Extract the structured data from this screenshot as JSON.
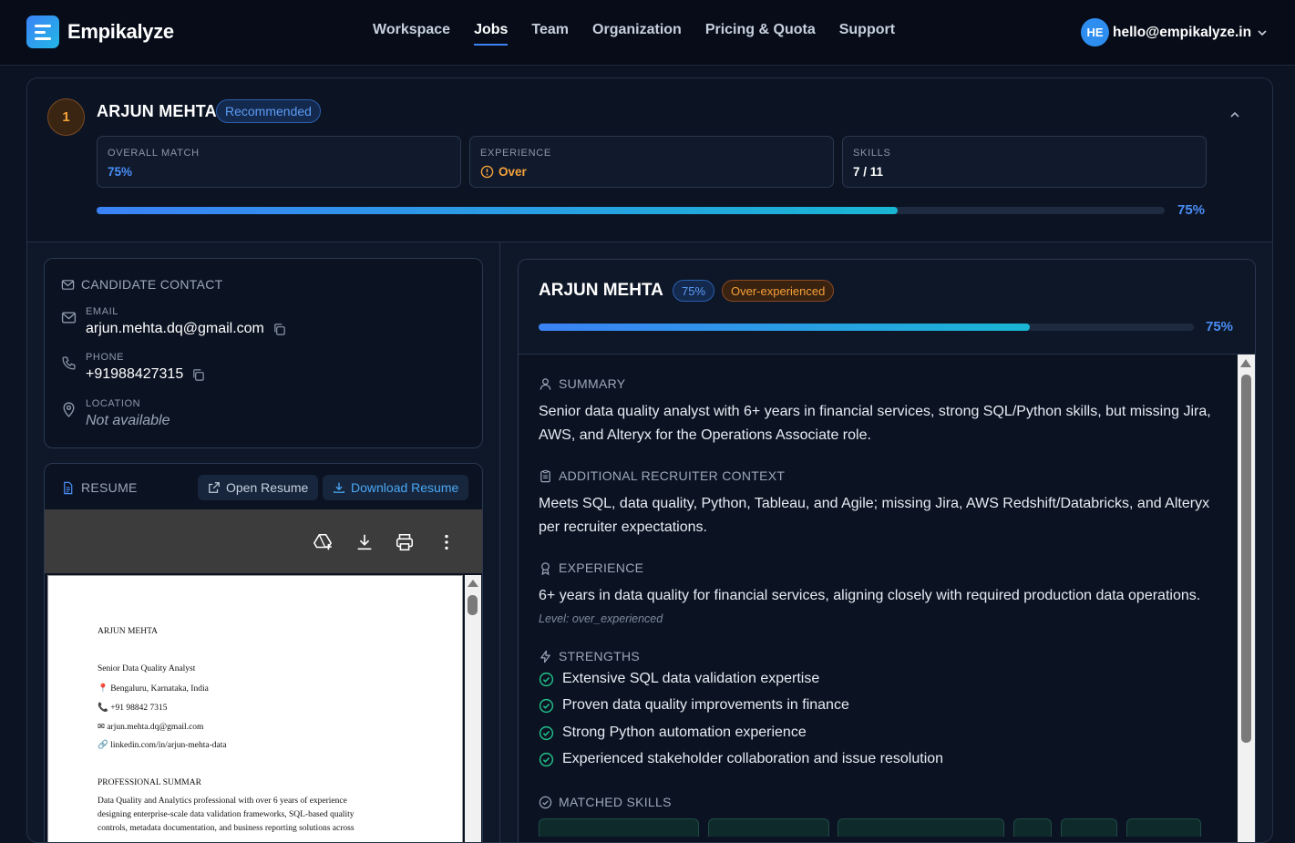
{
  "app": {
    "name": "Empikalyze"
  },
  "nav": {
    "items": [
      "Workspace",
      "Jobs",
      "Team",
      "Organization",
      "Pricing & Quota",
      "Support"
    ],
    "active": "Jobs"
  },
  "user": {
    "initials": "HE",
    "email": "hello@empikalyze.in"
  },
  "candidate": {
    "rank": "1",
    "name": "ARJUN MEHTA",
    "badge": "Recommended",
    "overall_match_label": "OVERALL MATCH",
    "overall_match": "75%",
    "experience_label": "EXPERIENCE",
    "experience": "Over",
    "skills_label": "SKILLS",
    "skills": "7 / 11",
    "match_progress": 0.75,
    "match_progress_text": "75%"
  },
  "contact": {
    "title": "CANDIDATE CONTACT",
    "email_label": "EMAIL",
    "email": "arjun.mehta.dq@gmail.com",
    "phone_label": "PHONE",
    "phone": "+91988427315",
    "location_label": "LOCATION",
    "location": "Not available"
  },
  "resume": {
    "title": "RESUME",
    "open_label": "Open Resume",
    "download_label": "Download Resume",
    "pdf_lines": [
      "ARJUN MEHTA",
      "Senior Data Quality Analyst",
      "📍 Bengaluru, Karnataka, India",
      "📞 +91 98842 7315",
      "✉ arjun.mehta.dq@gmail.com",
      "🔗 linkedin.com/in/arjun-mehta-data",
      "PROFESSIONAL SUMMAR",
      "Data Quality and Analytics professional with over 6 years of experience",
      "designing enterprise-scale data validation frameworks, SQL-based quality",
      "controls, metadata documentation, and business reporting solutions across"
    ]
  },
  "detail": {
    "name": "ARJUN MEHTA",
    "match_chip": "75%",
    "exp_chip": "Over-experienced",
    "progress": 0.75,
    "progress_text": "75%",
    "summary_title": "SUMMARY",
    "summary": "Senior data quality analyst with 6+ years in financial services, strong SQL/Python skills, but missing Jira, AWS, and Alteryx for the Operations Associate role.",
    "context_title": "ADDITIONAL RECRUITER CONTEXT",
    "context": "Meets SQL, data quality, Python, Tableau, and Agile; missing Jira, AWS Redshift/Databricks, and Alteryx per recruiter expectations.",
    "experience_title": "EXPERIENCE",
    "experience": "6+ years in data quality for financial services, aligning closely with required production data operations.",
    "experience_level": "Level: over_experienced",
    "strengths_title": "STRENGTHS",
    "strengths": [
      "Extensive SQL data validation expertise",
      "Proven data quality improvements in finance",
      "Strong Python automation experience",
      "Experienced stakeholder collaboration and issue resolution"
    ],
    "matched_title": "MATCHED SKILLS"
  },
  "colors": {
    "accent": "#3b82f6",
    "teal": "#19b6d4",
    "warning": "#f5a23a",
    "success": "#22c08a"
  }
}
